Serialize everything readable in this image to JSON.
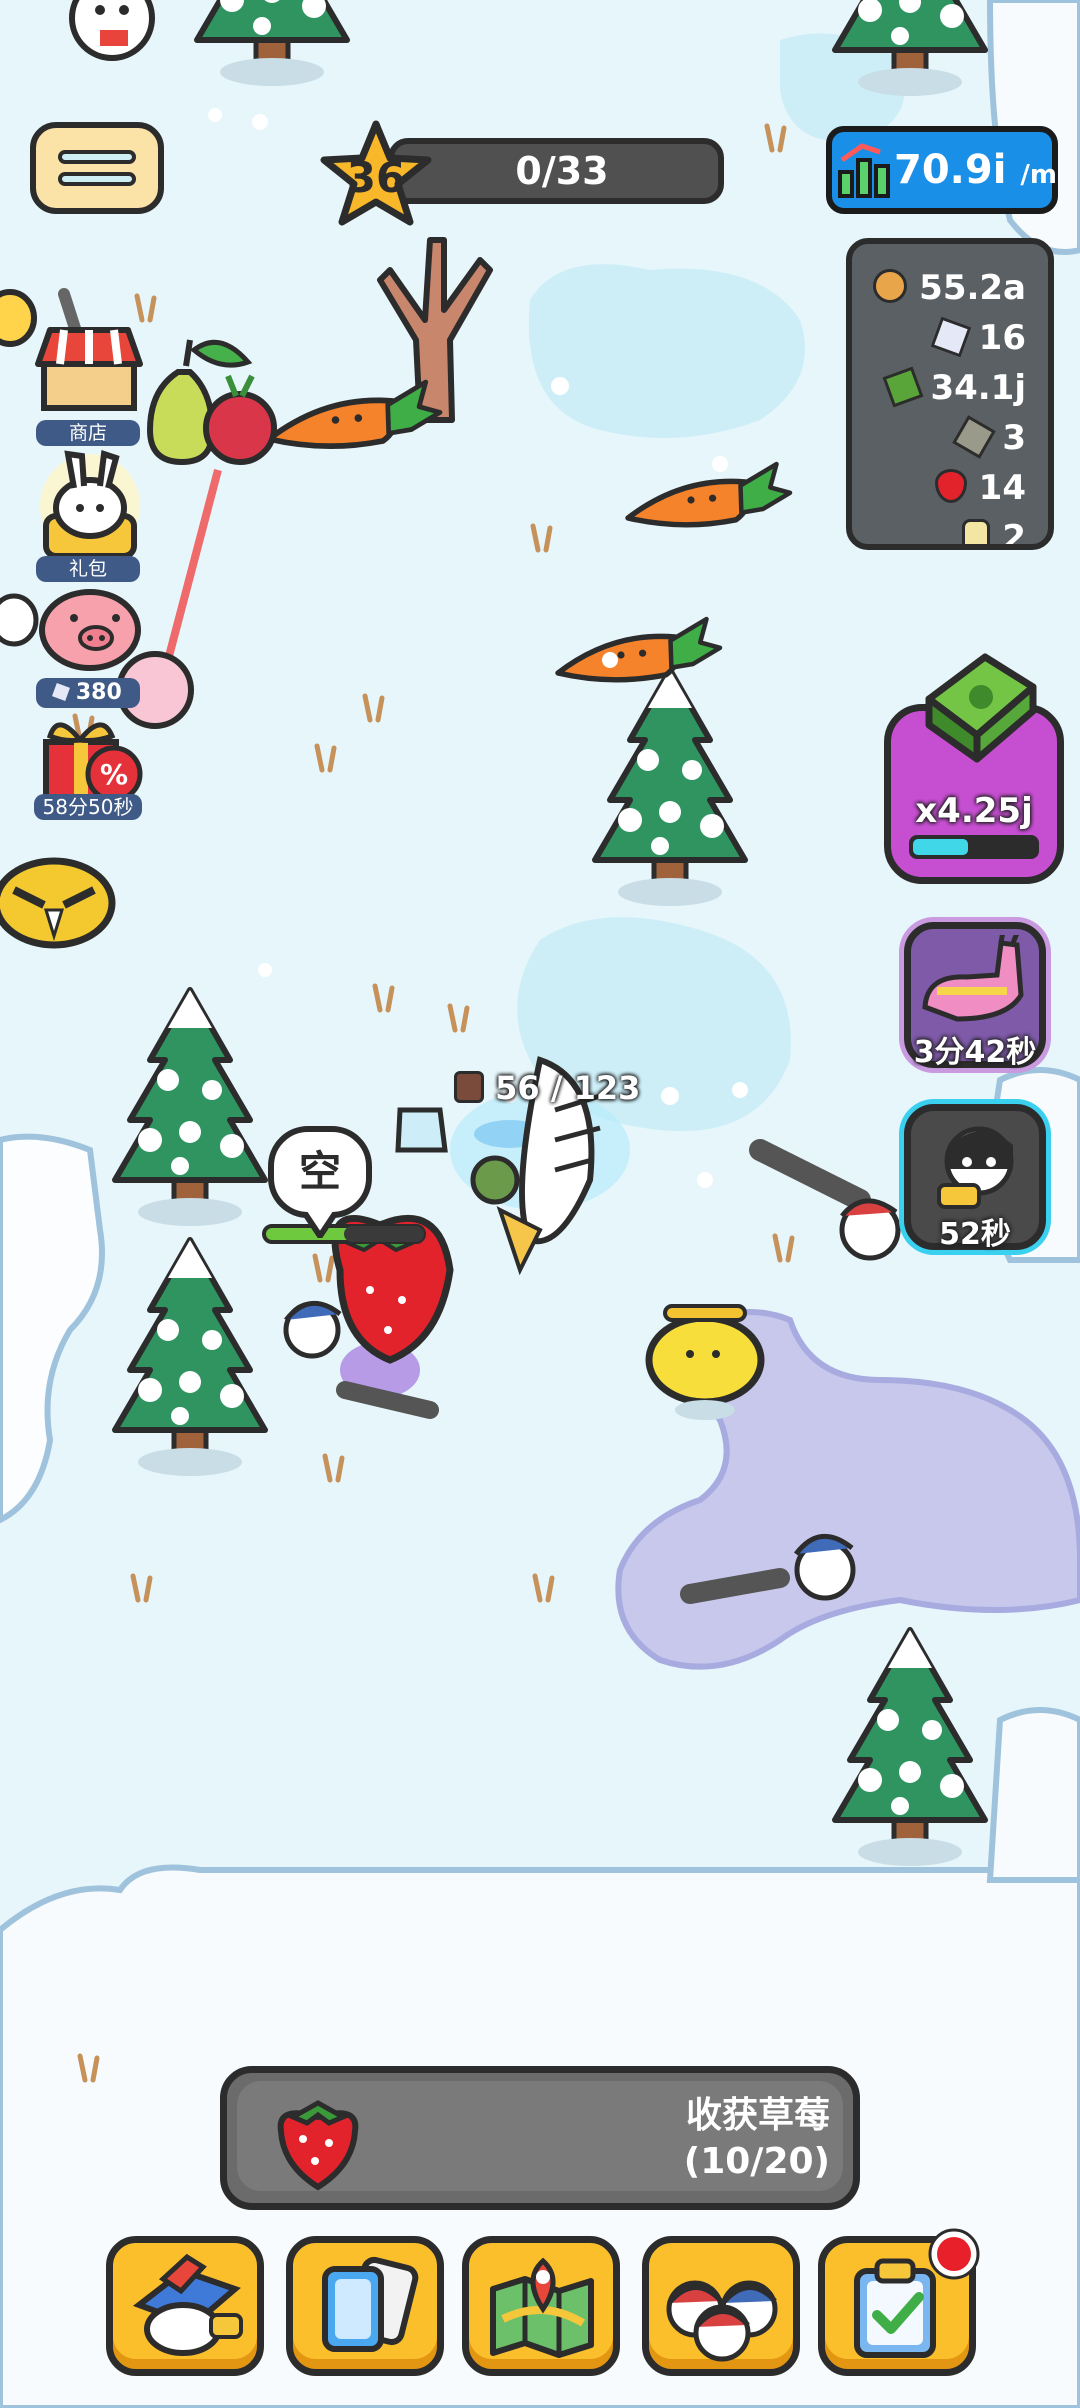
{
  "hud": {
    "level": "36",
    "level_progress": "0/33",
    "level_progress_fraction": 0,
    "income_value": "70.9i",
    "income_unit": "/m"
  },
  "resources": [
    {
      "icon": "cookie-icon",
      "value": "55.2a"
    },
    {
      "icon": "gem-icon",
      "value": "16"
    },
    {
      "icon": "cash-icon",
      "value": "34.1j"
    },
    {
      "icon": "ore-icon",
      "value": "3"
    },
    {
      "icon": "strawberry-icon",
      "value": "14"
    },
    {
      "icon": "potion-icon",
      "value": "2"
    }
  ],
  "side_menu": {
    "shop_label": "商店",
    "gift_label": "礼包",
    "piggy_value": "380",
    "sale_timer": "58分50秒"
  },
  "boosts": {
    "cash_multiplier": "x4.25j",
    "cash_progress": 0.45,
    "pinata_timer": "3分42秒",
    "thief_timer": "52秒"
  },
  "world": {
    "speech_bubble": "空",
    "backpack_counter": "56 / 123"
  },
  "quest": {
    "title": "收获草莓",
    "progress": "(10/20)"
  },
  "colors": {
    "hud_dark": "#505050",
    "income_blue": "#1a8fe8",
    "resource_panel": "#5a6063",
    "boost_purple": "#c64fd1",
    "nav_yellow": "#fcbf2c",
    "snow_ground": "#e6f6fb",
    "notification_red": "#e8202a"
  },
  "bottom_nav": [
    "heroes-button",
    "cards-button",
    "map-button",
    "workers-button",
    "tasks-button"
  ]
}
